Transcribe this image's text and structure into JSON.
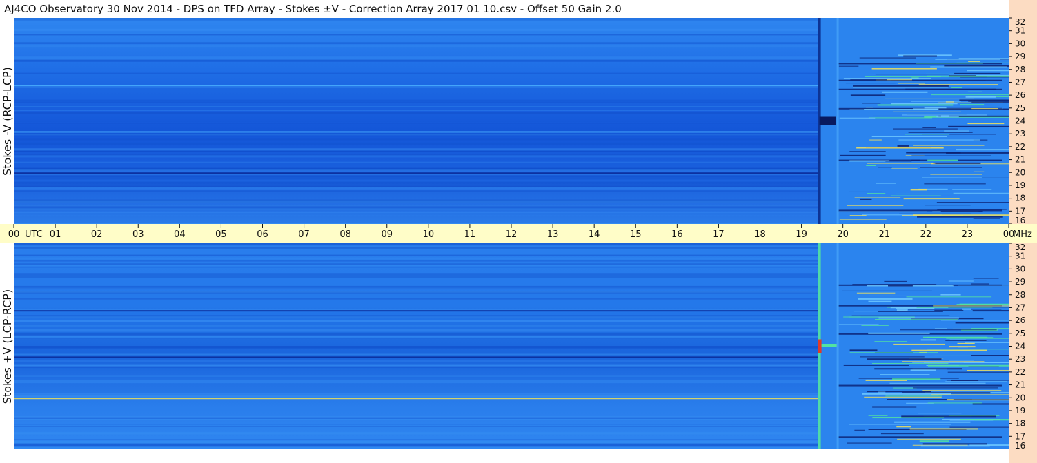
{
  "title": "AJ4CO Observatory  30 Nov 2014  -  DPS on TFD Array  -  Stokes ±V  -  Correction Array 2017 01 10.csv  -  Offset 50  Gain 2.0",
  "colors": {
    "background_blue": "#1a5fe0",
    "band_light": "#4ab0ff",
    "band_dark": "#0b2c9a",
    "hot": "#e03a2a",
    "warm": "#f2e25a",
    "green": "#53e3a0",
    "axis_bg": "#fcdcc2",
    "time_axis_bg": "#fffdc8"
  },
  "chart_data": [
    {
      "type": "heatmap",
      "name": "",
      "ylabel": "Stokes -V  (RCP-LCP)",
      "xlabel": "",
      "x_unit": "UTC",
      "y_unit": "MHz",
      "x_ticks": [
        "00",
        "01",
        "02",
        "03",
        "04",
        "05",
        "06",
        "07",
        "08",
        "09",
        "10",
        "11",
        "12",
        "13",
        "14",
        "15",
        "16",
        "17",
        "18",
        "19",
        "20",
        "21",
        "22",
        "23",
        "00"
      ],
      "y_ticks": [
        "16",
        "17",
        "18",
        "19",
        "20",
        "21",
        "22",
        "23",
        "24",
        "25",
        "26",
        "27",
        "28",
        "29",
        "30",
        "31",
        "32"
      ],
      "xlim": [
        0,
        24
      ],
      "ylim": [
        16,
        32
      ],
      "features": {
        "activity_start_utc": 19.4,
        "bright_lines_mhz": [
          23.2,
          26.8
        ],
        "dark_lines_mhz": [
          20.0
        ],
        "dark_burst_mhz": [
          24.0
        ],
        "interference_lines_mhz": [
          28.5,
          27.2,
          26.5,
          25.0,
          21.0,
          17.1
        ]
      }
    },
    {
      "type": "heatmap",
      "name": "",
      "ylabel": "Stokes +V  (LCP-RCP)",
      "xlabel": "",
      "x_unit": "UTC",
      "y_unit": "MHz",
      "x_ticks": [
        "00",
        "01",
        "02",
        "03",
        "04",
        "05",
        "06",
        "07",
        "08",
        "09",
        "10",
        "11",
        "12",
        "13",
        "14",
        "15",
        "16",
        "17",
        "18",
        "19",
        "20",
        "21",
        "22",
        "23",
        "00"
      ],
      "y_ticks": [
        "16",
        "17",
        "18",
        "19",
        "20",
        "21",
        "22",
        "23",
        "24",
        "25",
        "26",
        "27",
        "28",
        "29",
        "30",
        "31",
        "32"
      ],
      "xlim": [
        0,
        24
      ],
      "ylim": [
        16,
        32
      ],
      "features": {
        "activity_start_utc": 19.4,
        "bright_lines_mhz": [
          20.0
        ],
        "dark_lines_mhz": [
          23.2,
          26.8
        ],
        "hot_burst_mhz": [
          24.0
        ],
        "interference_lines_mhz": [
          28.8,
          27.2,
          25.0,
          21.0,
          17.0
        ]
      }
    }
  ],
  "time_axis": {
    "utc_label": "UTC",
    "mhz_label": "MHz"
  }
}
